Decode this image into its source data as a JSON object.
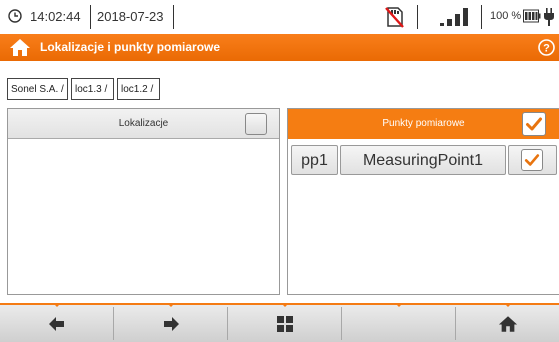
{
  "status": {
    "time": "14:02:44",
    "date": "2018-07-23",
    "battery_percent": "100 %",
    "signal_level": 4,
    "icons": [
      "clock-icon",
      "no-memory-card-icon",
      "signal-strength-icon",
      "battery-icon",
      "power-plug-icon"
    ]
  },
  "title_bar": {
    "title": "Lokalizacje i punkty pomiarowe",
    "icons": [
      "home-icon",
      "help-icon"
    ]
  },
  "breadcrumbs": [
    "Sonel S.A. /",
    "loc1.3 /",
    "loc1.2 /"
  ],
  "left_panel": {
    "title": "Lokalizacje",
    "select_all_checked": false,
    "items": []
  },
  "right_panel": {
    "title": "Punkty pomiarowe",
    "select_all_checked": true,
    "items": [
      {
        "id": "pp1",
        "name": "MeasuringPoint1",
        "checked": true
      }
    ]
  },
  "toolbar": {
    "buttons": [
      "arrow-left-icon",
      "arrow-right-icon",
      "grid-icon",
      "",
      "home-icon"
    ]
  },
  "colors": {
    "accent": "#f57d12",
    "check": "#e8740f"
  }
}
